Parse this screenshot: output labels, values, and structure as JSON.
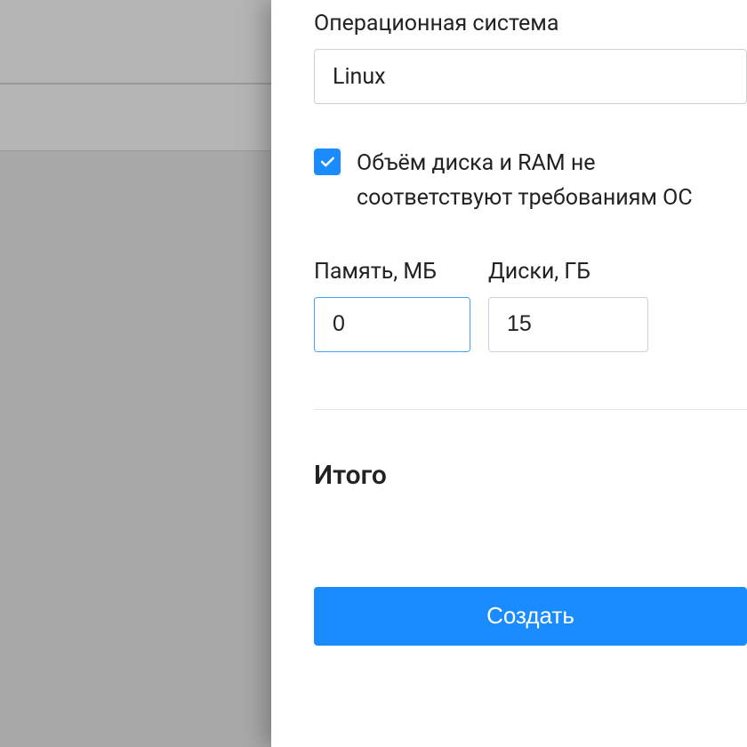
{
  "form": {
    "os_label": "Операционная система",
    "os_value": "Linux",
    "disk_ram_warning": "Объём диска и RAM не соответствуют требованиям ОС",
    "memory_label": "Память, МБ",
    "memory_value": "0",
    "disk_label": "Диски, ГБ",
    "disk_value": "15",
    "total_label": "Итого",
    "create_label": "Создать"
  },
  "colors": {
    "accent": "#1a8cff",
    "border": "#d0d0d0",
    "focus_border": "#40a0ff"
  }
}
